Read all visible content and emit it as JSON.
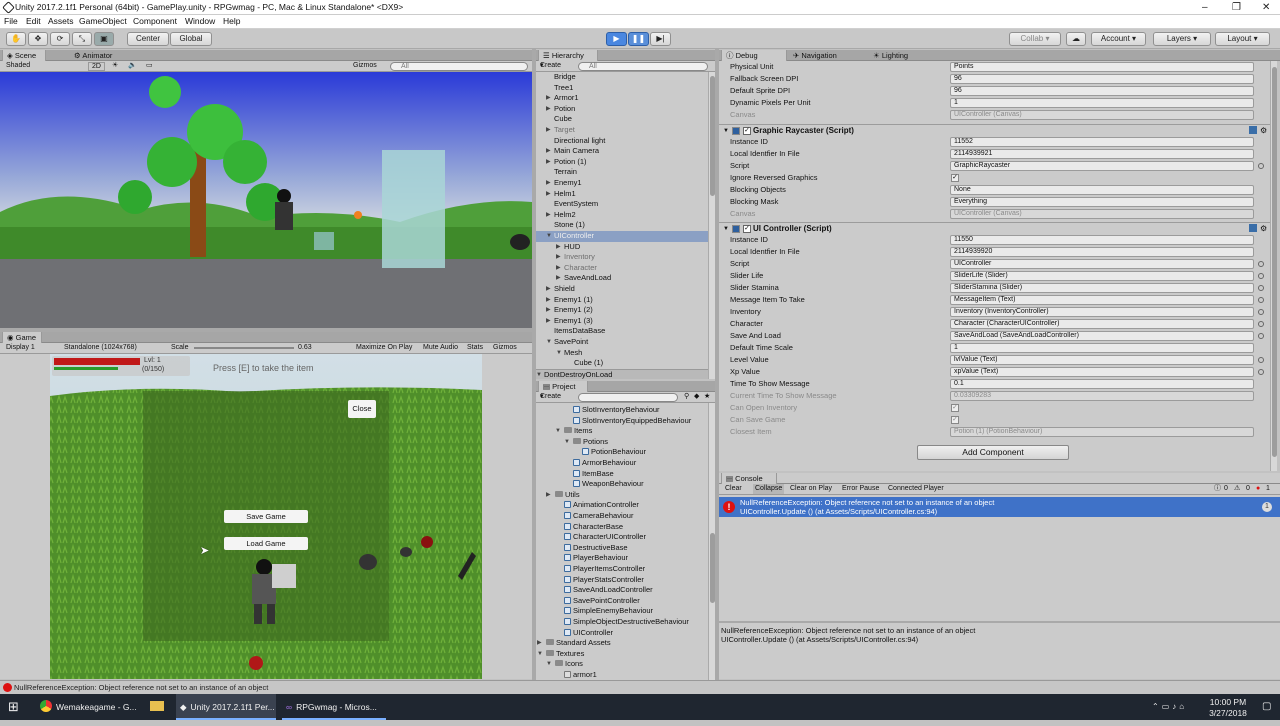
{
  "window": {
    "title": "Unity 2017.2.1f1 Personal (64bit) - GamePlay.unity - RPGwmag - PC, Mac & Linux Standalone* <DX9>",
    "controls": [
      "–",
      "❐",
      "✕"
    ]
  },
  "menu": [
    "File",
    "Edit",
    "Assets",
    "GameObject",
    "Component",
    "Window",
    "Help"
  ],
  "toolbar": {
    "center": "Center",
    "global": "Global",
    "collab": "Collab",
    "account": "Account",
    "layers": "Layers",
    "layout": "Layout"
  },
  "scene": {
    "tabs": [
      "Scene",
      "Animator"
    ],
    "shading": "Shaded",
    "mode": "2D",
    "gizmos": "Gizmos",
    "search": "All"
  },
  "game": {
    "tab": "Game",
    "display": "Display 1",
    "resolution": "Standalone (1024x768)",
    "scale_label": "Scale",
    "scale_value": "0.63",
    "maximize": "Maximize On Play",
    "mute": "Mute Audio",
    "stats": "Stats",
    "gizmos": "Gizmos",
    "hud_level": "Lvl: 1",
    "hud_xp": "(0/150)",
    "prompt": "Press [E] to take the item",
    "close": "Close",
    "save": "Save Game",
    "load": "Load Game"
  },
  "hierarchy": {
    "tab": "Hierarchy",
    "create": "Create",
    "search": "All",
    "items": [
      {
        "label": "Bridge",
        "indent": 1,
        "arrow": false
      },
      {
        "label": "Tree1",
        "indent": 1,
        "arrow": false
      },
      {
        "label": "Armor1",
        "indent": 1,
        "arrow": true
      },
      {
        "label": "Potion",
        "indent": 1,
        "arrow": true
      },
      {
        "label": "Cube",
        "indent": 1,
        "arrow": false
      },
      {
        "label": "Target",
        "indent": 1,
        "arrow": true,
        "dim": true
      },
      {
        "label": "Directional light",
        "indent": 1,
        "arrow": false
      },
      {
        "label": "Main Camera",
        "indent": 1,
        "arrow": true
      },
      {
        "label": "Potion (1)",
        "indent": 1,
        "arrow": true
      },
      {
        "label": "Terrain",
        "indent": 1,
        "arrow": false
      },
      {
        "label": "Enemy1",
        "indent": 1,
        "arrow": true
      },
      {
        "label": "Helm1",
        "indent": 1,
        "arrow": true
      },
      {
        "label": "EventSystem",
        "indent": 1,
        "arrow": false
      },
      {
        "label": "Helm2",
        "indent": 1,
        "arrow": true
      },
      {
        "label": "Stone (1)",
        "indent": 1,
        "arrow": false
      },
      {
        "label": "UIController",
        "indent": 1,
        "arrow": true,
        "sel": true,
        "open": true
      },
      {
        "label": "HUD",
        "indent": 2,
        "arrow": true
      },
      {
        "label": "Inventory",
        "indent": 2,
        "arrow": true,
        "dim": true
      },
      {
        "label": "Character",
        "indent": 2,
        "arrow": true,
        "dim": true
      },
      {
        "label": "SaveAndLoad",
        "indent": 2,
        "arrow": true
      },
      {
        "label": "Shield",
        "indent": 1,
        "arrow": true
      },
      {
        "label": "Enemy1 (1)",
        "indent": 1,
        "arrow": true
      },
      {
        "label": "Enemy1 (2)",
        "indent": 1,
        "arrow": true
      },
      {
        "label": "Enemy1 (3)",
        "indent": 1,
        "arrow": true
      },
      {
        "label": "ItemsDataBase",
        "indent": 1,
        "arrow": false
      },
      {
        "label": "SavePoint",
        "indent": 1,
        "arrow": true,
        "open": true
      },
      {
        "label": "Mesh",
        "indent": 2,
        "arrow": true,
        "open": true
      },
      {
        "label": "Cube (1)",
        "indent": 3,
        "arrow": false
      },
      {
        "label": "DontDestroyOnLoad",
        "indent": 0,
        "arrow": true,
        "open": true,
        "bar": true
      }
    ]
  },
  "project": {
    "tab": "Project",
    "create": "Create",
    "items": [
      {
        "label": "SlotInventoryBehaviour",
        "indent": 3,
        "kind": "script"
      },
      {
        "label": "SlotInventoryEquippedBehaviour",
        "indent": 3,
        "kind": "script"
      },
      {
        "label": "Items",
        "indent": 2,
        "kind": "folder",
        "open": true
      },
      {
        "label": "Potions",
        "indent": 3,
        "kind": "folder",
        "open": true
      },
      {
        "label": "PotionBehaviour",
        "indent": 4,
        "kind": "script"
      },
      {
        "label": "ArmorBehaviour",
        "indent": 3,
        "kind": "script"
      },
      {
        "label": "ItemBase",
        "indent": 3,
        "kind": "script"
      },
      {
        "label": "WeaponBehaviour",
        "indent": 3,
        "kind": "script"
      },
      {
        "label": "Utils",
        "indent": 1,
        "kind": "folder",
        "arrow": true
      },
      {
        "label": "AnimationController",
        "indent": 2,
        "kind": "script"
      },
      {
        "label": "CameraBehaviour",
        "indent": 2,
        "kind": "script"
      },
      {
        "label": "CharacterBase",
        "indent": 2,
        "kind": "script"
      },
      {
        "label": "CharacterUIController",
        "indent": 2,
        "kind": "script"
      },
      {
        "label": "DestructiveBase",
        "indent": 2,
        "kind": "script"
      },
      {
        "label": "PlayerBehaviour",
        "indent": 2,
        "kind": "script"
      },
      {
        "label": "PlayerItemsController",
        "indent": 2,
        "kind": "script"
      },
      {
        "label": "PlayerStatsController",
        "indent": 2,
        "kind": "script"
      },
      {
        "label": "SaveAndLoadController",
        "indent": 2,
        "kind": "script"
      },
      {
        "label": "SavePointController",
        "indent": 2,
        "kind": "script"
      },
      {
        "label": "SimpleEnemyBehaviour",
        "indent": 2,
        "kind": "script"
      },
      {
        "label": "SimpleObjectDestructiveBehaviour",
        "indent": 2,
        "kind": "script"
      },
      {
        "label": "UIController",
        "indent": 2,
        "kind": "script"
      },
      {
        "label": "Standard Assets",
        "indent": 0,
        "kind": "folder",
        "arrow": true
      },
      {
        "label": "Textures",
        "indent": 0,
        "kind": "folder",
        "open": true
      },
      {
        "label": "Icons",
        "indent": 1,
        "kind": "folder",
        "open": true
      },
      {
        "label": "armor1",
        "indent": 2,
        "kind": "image"
      }
    ]
  },
  "inspector": {
    "tabs": [
      "Debug",
      "Navigation",
      "Lighting"
    ],
    "top_rows": [
      {
        "label": "Physical Unit",
        "value": "Points"
      },
      {
        "label": "Fallback Screen DPI",
        "value": "96"
      },
      {
        "label": "Default Sprite DPI",
        "value": "96"
      },
      {
        "label": "Dynamic Pixels Per Unit",
        "value": "1"
      },
      {
        "label": "Canvas",
        "value": "UIController (Canvas)",
        "dis": true
      }
    ],
    "graphic_raycaster": {
      "title": "Graphic Raycaster (Script)",
      "rows": [
        {
          "label": "Instance ID",
          "value": "11552"
        },
        {
          "label": "Local Identfier In File",
          "value": "2114939921"
        },
        {
          "label": "Script",
          "value": "GraphicRaycaster",
          "ref": true
        },
        {
          "label": "Ignore Reversed Graphics",
          "value": "✓",
          "check": true
        },
        {
          "label": "Blocking Objects",
          "value": "None"
        },
        {
          "label": "Blocking Mask",
          "value": "Everything"
        },
        {
          "label": "Canvas",
          "value": "UIController (Canvas)",
          "dis": true
        }
      ]
    },
    "ui_controller": {
      "title": "UI Controller (Script)",
      "rows": [
        {
          "label": "Instance ID",
          "value": "11550"
        },
        {
          "label": "Local Identfier In File",
          "value": "2114939920"
        },
        {
          "label": "Script",
          "value": "UIController",
          "ref": true
        },
        {
          "label": "Slider Life",
          "value": "SliderLife (Slider)",
          "ref": true
        },
        {
          "label": "Slider Stamina",
          "value": "SliderStamina (Slider)",
          "ref": true
        },
        {
          "label": "Message Item To Take",
          "value": "MessageItem (Text)",
          "ref": true
        },
        {
          "label": "Inventory",
          "value": "Inventory (InventoryController)",
          "ref": true
        },
        {
          "label": "Character",
          "value": "Character (CharacterUIController)",
          "ref": true
        },
        {
          "label": "Save And Load",
          "value": "SaveAndLoad (SaveAndLoadController)",
          "ref": true
        },
        {
          "label": "Default Time Scale",
          "value": "1"
        },
        {
          "label": "Level Value",
          "value": "lvlValue (Text)",
          "ref": true
        },
        {
          "label": "Xp Value",
          "value": "xpValue (Text)",
          "ref": true
        },
        {
          "label": "Time To Show Message",
          "value": "0.1"
        },
        {
          "label": "Current Time To Show Message",
          "value": "0.03309283",
          "dis": true
        },
        {
          "label": "Can Open Inventory",
          "value": "✓",
          "check": true,
          "dis": true
        },
        {
          "label": "Can Save Game",
          "value": "✓",
          "check": true,
          "dis": true
        },
        {
          "label": "Closest Item",
          "value": "Potion (1) (PotionBehaviour)",
          "dis": true
        }
      ]
    },
    "add_component": "Add Component"
  },
  "console": {
    "tab": "Console",
    "buttons": [
      "Clear",
      "Collapse",
      "Clear on Play",
      "Error Pause",
      "Connected Player"
    ],
    "counts": [
      "0",
      "0",
      "1"
    ],
    "error_line1": "NullReferenceException: Object reference not set to an instance of an object",
    "error_line2": "UIController.Update () (at Assets/Scripts/UIController.cs:94)",
    "error_count": "1",
    "detail_line1": "NullReferenceException: Object reference not set to an instance of an object",
    "detail_line2": "UIController.Update () (at Assets/Scripts/UIController.cs:94)"
  },
  "status": "NullReferenceException: Object reference not set to an instance of an object",
  "taskbar": {
    "apps": [
      "Wemakeagame - G...",
      "Unity 2017.2.1f1 Per...",
      "RPGwmag - Micros..."
    ],
    "time": "10:00 PM",
    "date": "3/27/2018"
  },
  "colors": {
    "selection": "#3f72c8",
    "error": "#d11",
    "accent": "#4a87e0"
  }
}
